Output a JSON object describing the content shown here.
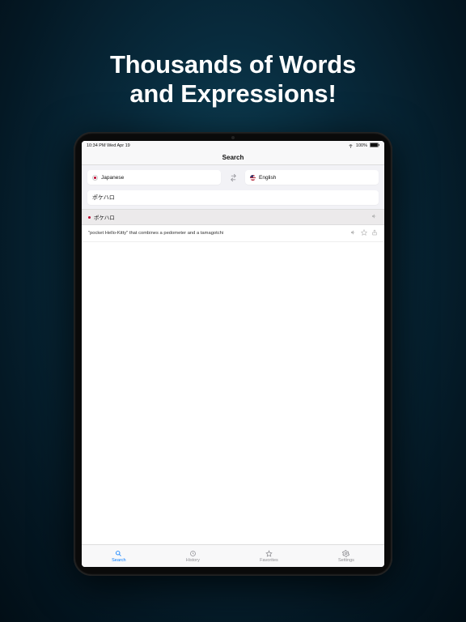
{
  "promo": {
    "headline_line1": "Thousands of Words",
    "headline_line2": "and Expressions!"
  },
  "status": {
    "time_date": "10:34 PM   Wed Apr 19",
    "battery": "100%"
  },
  "nav": {
    "title": "Search"
  },
  "languages": {
    "source": "Japanese",
    "target": "English"
  },
  "search": {
    "value": "ポケハロ"
  },
  "result": {
    "headword": "ポケハロ",
    "definition": "\"pocket Hello-Kitty\" that combines a pedometer and a tamagotchi"
  },
  "tabs": {
    "search": "Search",
    "history": "History",
    "favorites": "Favorites",
    "settings": "Settings"
  }
}
